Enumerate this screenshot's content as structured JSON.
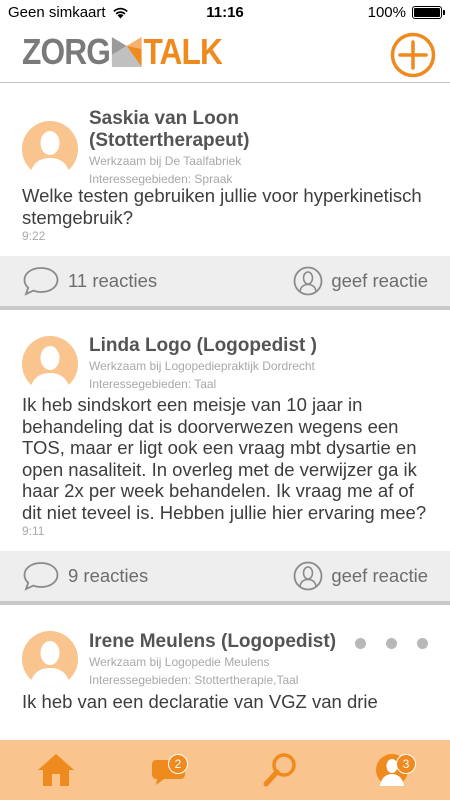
{
  "status_bar": {
    "carrier": "Geen simkaart",
    "time": "11:16",
    "battery": "100%"
  },
  "header": {
    "logo_left": "ZORG",
    "logo_right": "TALK",
    "add_icon": "plus-circle-icon"
  },
  "colors": {
    "accent": "#ef8a1e",
    "avatar_bg": "#f9c48d",
    "tabbar_bg": "#f9c48d",
    "action_bar_bg": "#eeeeee"
  },
  "posts": [
    {
      "author_line1": "Saskia van Loon",
      "author_line2": "(Stottertherapeut)",
      "workplace": "Werkzaam bij De Taalfabriek",
      "interests": "Interessegebieden: Spraak",
      "text": "Welke testen gebruiken jullie voor hyperkinetisch stemgebruik?",
      "time": "9:22",
      "reactions": "11 reacties",
      "reply": "geef reactie"
    },
    {
      "author_line1": "Linda Logo (Logopedist )",
      "workplace": "Werkzaam bij Logopediepraktijk Dordrecht",
      "interests": "Interessegebieden: Taal",
      "text": "Ik heb sindskort een meisje van 10 jaar in behandeling dat is doorverwezen wegens een TOS, maar er ligt ook een vraag mbt dysartie en open nasaliteit. In overleg met de verwijzer ga ik haar 2x per week behandelen. Ik vraag me af of dit niet teveel is. Hebben jullie hier ervaring mee?",
      "time": "9:11",
      "reactions": "9 reacties",
      "reply": "geef reactie"
    },
    {
      "author_line1": "Irene Meulens (Logopedist)",
      "workplace": "Werkzaam bij Logopedie Meulens",
      "interests": "Interessegebieden: Stottertherapie,Taal",
      "text": "Ik heb van een declaratie van VGZ van drie"
    }
  ],
  "tabbar": {
    "home_icon": "home-icon",
    "messages_icon": "chat-bubble-icon",
    "messages_badge": "2",
    "search_icon": "search-icon",
    "profile_icon": "profile-icon",
    "profile_badge": "3"
  }
}
